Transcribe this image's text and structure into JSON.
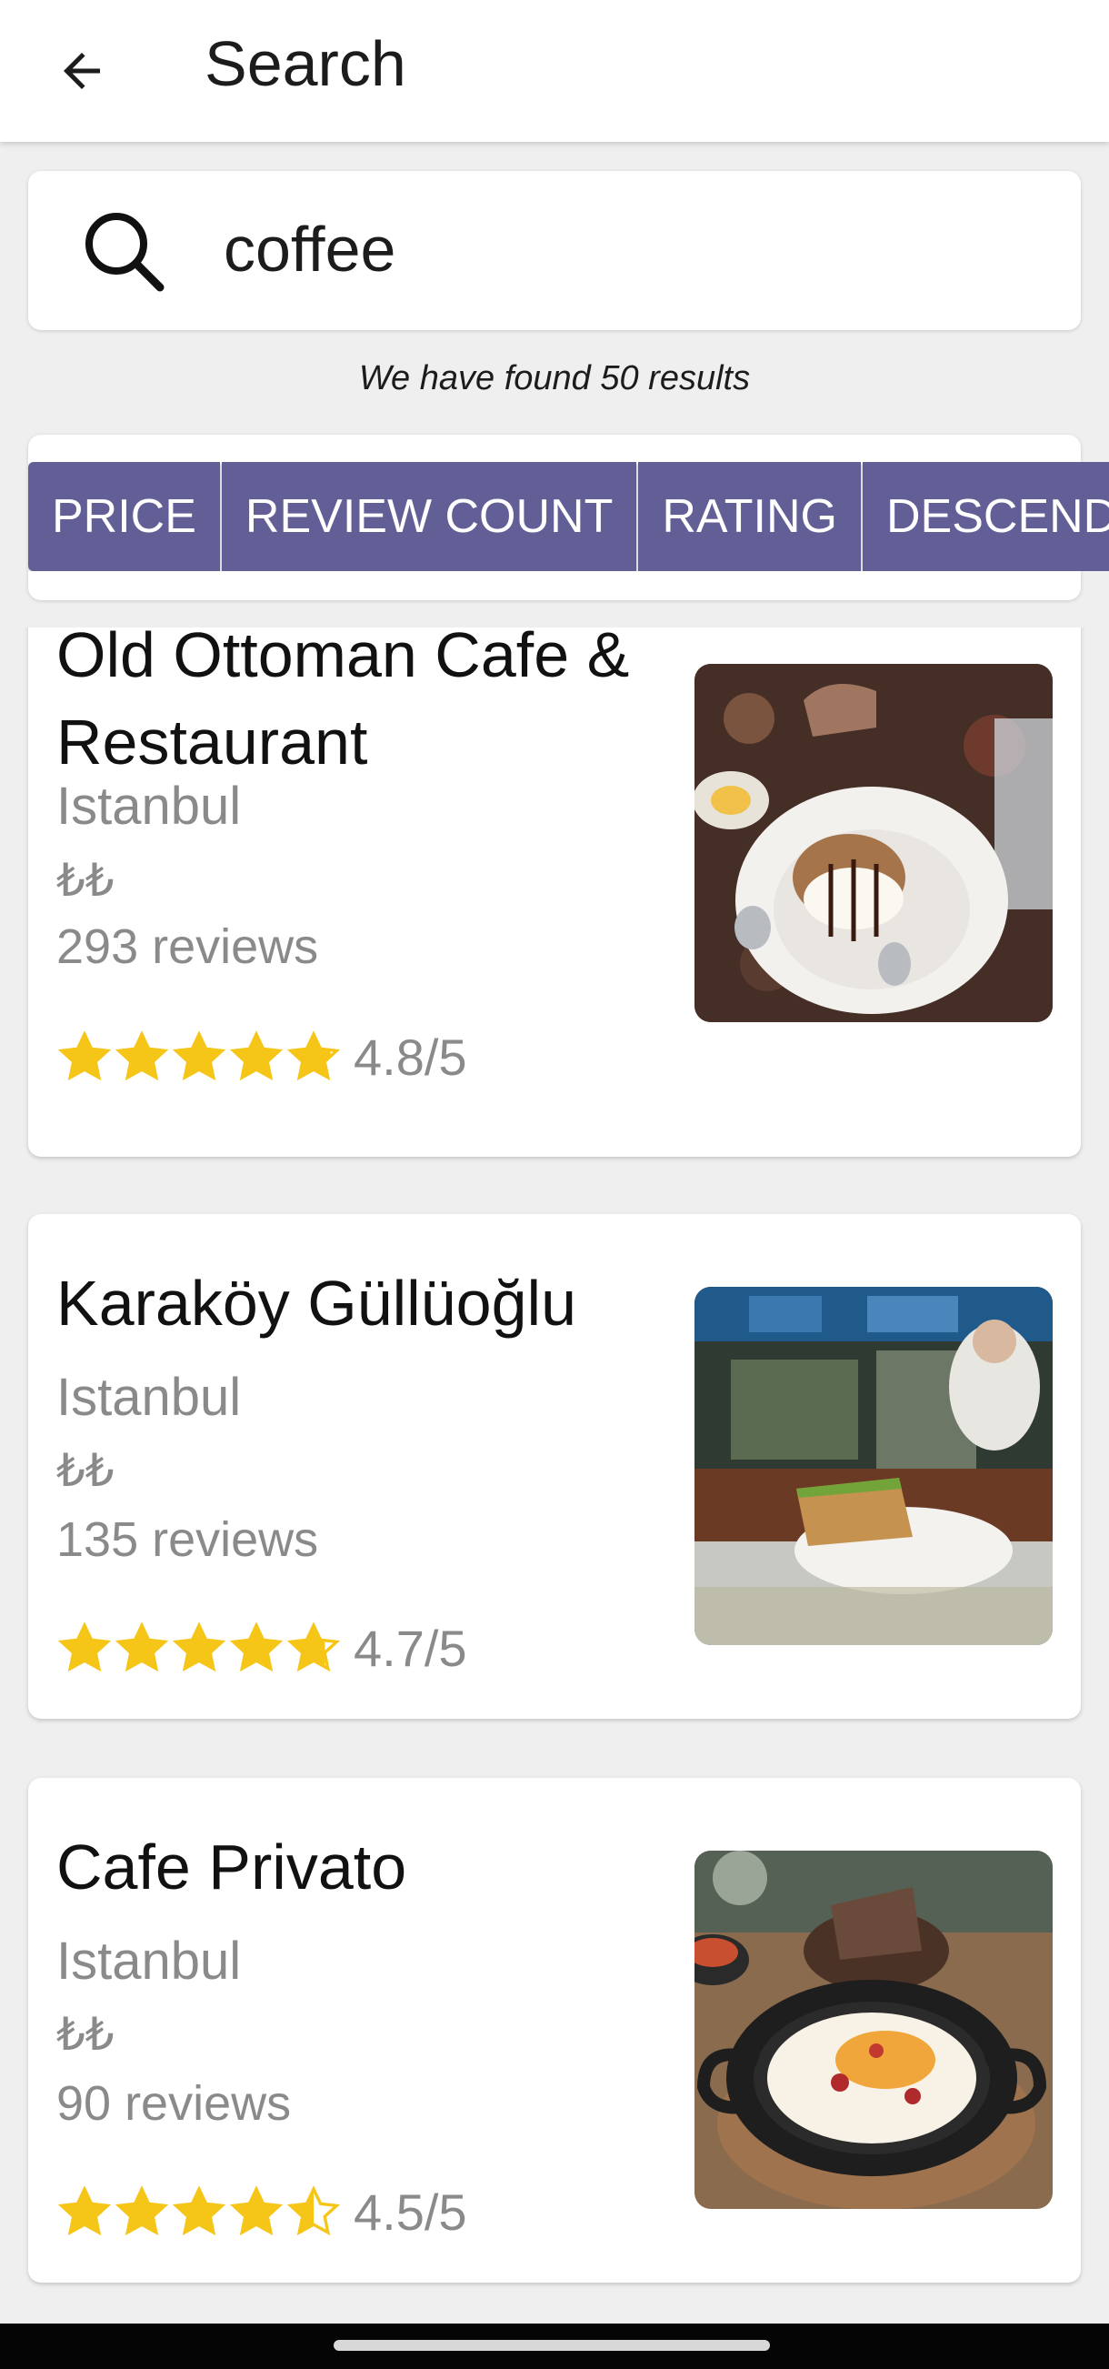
{
  "appbar": {
    "title": "Search",
    "back_icon": "arrow-left-icon"
  },
  "search": {
    "value": "coffee",
    "icon": "search-icon"
  },
  "results_text": "We have found 50 results",
  "filters": [
    "PRICE",
    "REVIEW COUNT",
    "RATING",
    "DESCENDING"
  ],
  "colors": {
    "chip": "#625e96",
    "star": "#f5c518",
    "muted_text": "#8a8a8a"
  },
  "results": [
    {
      "name": "Old Ottoman Cafe & Restaurant",
      "city": "Istanbul",
      "price": "₺₺",
      "reviews": "293 reviews",
      "rating": 4.8,
      "rating_text": "4.8/5",
      "image": "dessert-plate-photo"
    },
    {
      "name": "Karaköy Güllüoğlu",
      "city": "Istanbul",
      "price": "₺₺",
      "reviews": "135 reviews",
      "rating": 4.7,
      "rating_text": "4.7/5",
      "image": "baklava-slice-photo"
    },
    {
      "name": "Cafe Privato",
      "city": "Istanbul",
      "price": "₺₺",
      "reviews": "90 reviews",
      "rating": 4.5,
      "rating_text": "4.5/5",
      "image": "menemen-pan-photo"
    }
  ]
}
